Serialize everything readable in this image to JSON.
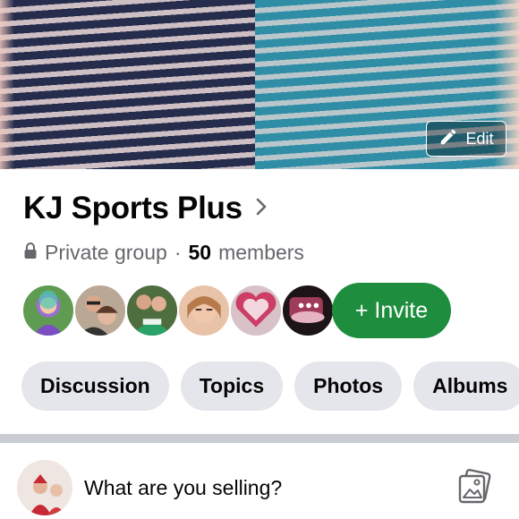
{
  "cover": {
    "edit_label": "Edit"
  },
  "group": {
    "name": "KJ Sports Plus",
    "privacy": "Private group",
    "separator": "·",
    "member_count": "50",
    "member_word": "members"
  },
  "members_row": {
    "invite_label": "+ Invite"
  },
  "tabs": [
    {
      "label": "Discussion"
    },
    {
      "label": "Topics"
    },
    {
      "label": "Photos"
    },
    {
      "label": "Albums"
    }
  ],
  "composer": {
    "placeholder": "What are you selling?"
  },
  "colors": {
    "invite_green": "#1e8e3e",
    "chip_gray": "#e4e6eb",
    "text_primary": "#050505",
    "text_secondary": "#65676b"
  }
}
